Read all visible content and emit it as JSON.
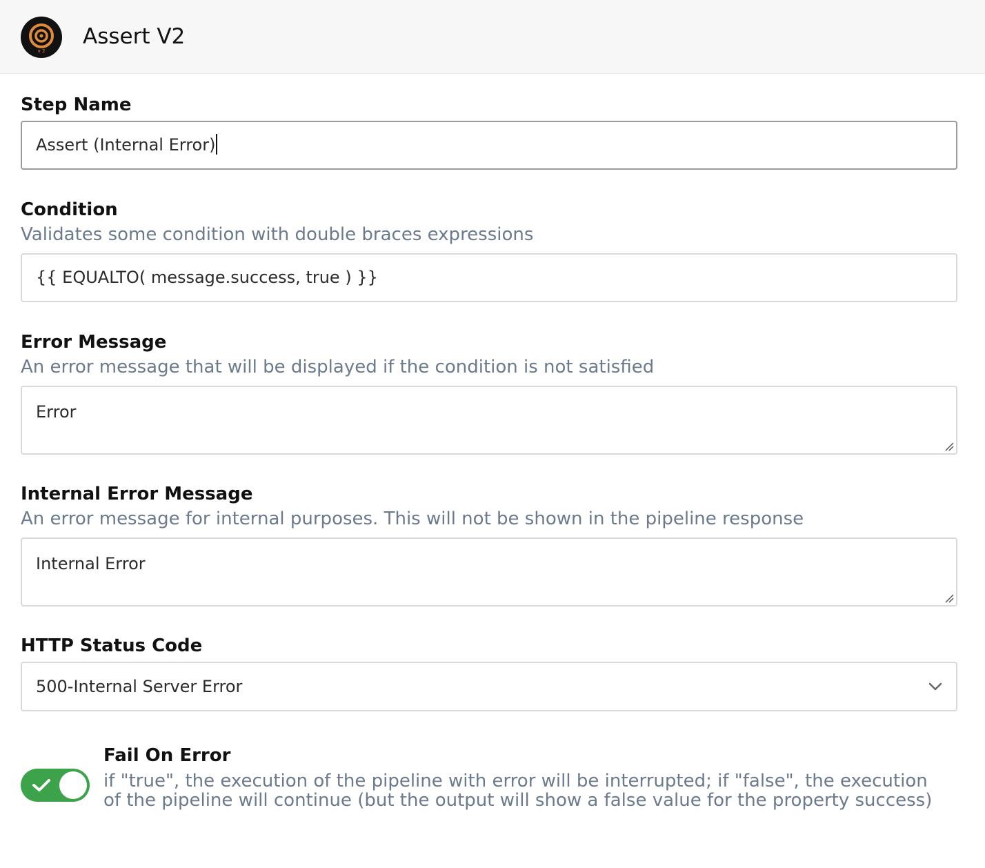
{
  "header": {
    "title": "Assert V2",
    "logo_icon": "target-v2-logo-icon",
    "logo_text": "v 2"
  },
  "step_name": {
    "label": "Step Name",
    "value": "Assert (Internal Error)"
  },
  "condition": {
    "label": "Condition",
    "description": "Validates some condition with double braces expressions",
    "value": "{{ EQUALTO( message.success, true ) }}"
  },
  "error_message": {
    "label": "Error Message",
    "description": "An error message that will be displayed if the condition is not satisfied",
    "value": "Error"
  },
  "internal_error_message": {
    "label": "Internal Error Message",
    "description": "An error message for internal purposes. This will not be shown in the pipeline response",
    "value": "Internal Error"
  },
  "http_status_code": {
    "label": "HTTP Status Code",
    "selected": "500-Internal Server Error"
  },
  "fail_on_error": {
    "label": "Fail On Error",
    "description": "if \"true\", the execution of the pipeline with error will be interrupted; if \"false\", the execution of the pipeline will continue (but the output will show a false value for the property success)",
    "enabled": true
  },
  "colors": {
    "toggle_on": "#3da34a",
    "description_text": "#6b7a8c",
    "logo_ring": "#e08a3c"
  }
}
